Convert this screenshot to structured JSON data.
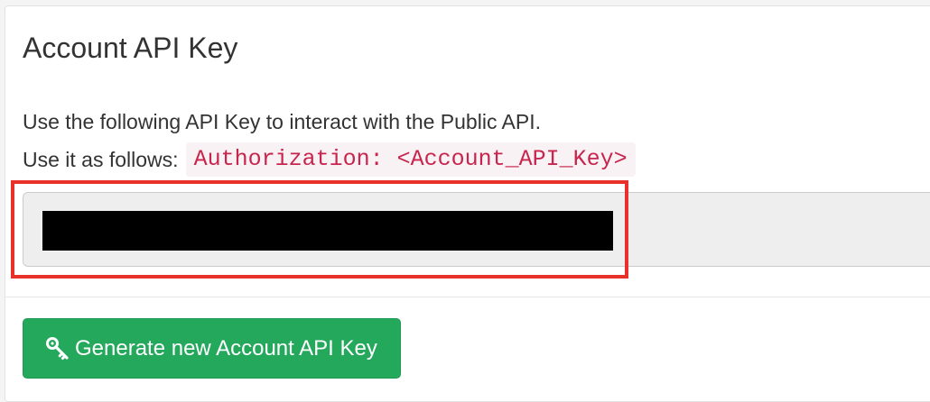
{
  "panel": {
    "title": "Account API Key",
    "description_line1": "Use the following API Key to interact with the Public API.",
    "description_line2_prefix": "Use it as follows:",
    "header_format": "Authorization: <Account_API_Key>"
  },
  "api_key_field": {
    "value": "",
    "redacted": true
  },
  "actions": {
    "generate_label": "Generate new Account API Key",
    "generate_icon": "key-icon"
  },
  "colors": {
    "button_green": "#23a85c",
    "code_text": "#c7254e",
    "highlight_red": "#e8312a"
  }
}
